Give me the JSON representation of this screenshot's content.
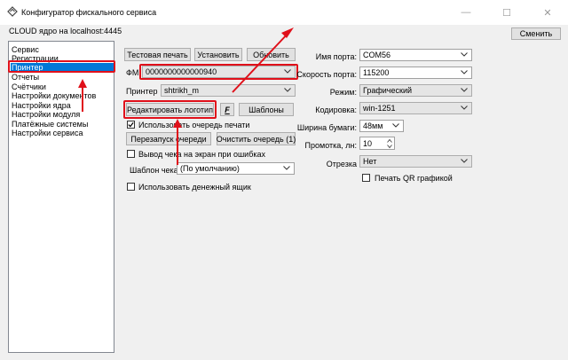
{
  "window": {
    "title": "Конфигуратор фискального сервиса",
    "minimize_glyph": "—",
    "maximize_glyph": "☐",
    "close_glyph": "✕"
  },
  "server_label": "CLOUD ядро на localhost:4445",
  "change_button": "Сменить",
  "sidebar": {
    "items": [
      {
        "label": "Сервис"
      },
      {
        "label": "Регистрации"
      },
      {
        "label": "Принтер",
        "selected": true
      },
      {
        "label": "Отчеты"
      },
      {
        "label": "Счётчики"
      },
      {
        "label": "Настройки документов"
      },
      {
        "label": "Настройки ядра"
      },
      {
        "label": "Настройки модуля"
      },
      {
        "label": "Платёжные системы"
      },
      {
        "label": "Настройки сервиса"
      }
    ]
  },
  "printer": {
    "test_print": "Тестовая печать",
    "install": "Установить",
    "update": "Обновить",
    "fm_label": "ФМ",
    "fm_value": "0000000000000940",
    "printer_label": "Принтер",
    "printer_value": "shtrikh_m",
    "edit_logo": "Редактировать логотип",
    "font_button": "F",
    "templates": "Шаблоны",
    "use_queue": "Использовать очередь печати",
    "use_queue_checked": true,
    "restart_queue": "Перезапуск очереди",
    "clear_queue": "Очистить очередь (1)",
    "show_on_error": "Вывод чека на экран при ошибках",
    "show_on_error_checked": false,
    "template_label": "Шаблон чека",
    "template_value": "(По умолчанию)",
    "cash_drawer": "Использовать денежный ящик",
    "cash_drawer_checked": false
  },
  "port": {
    "port_name_label": "Имя порта:",
    "port_name_value": "COM56",
    "speed_label": "Скорость порта:",
    "speed_value": "115200",
    "mode_label": "Режим:",
    "mode_value": "Графический",
    "encoding_label": "Кодировка:",
    "encoding_value": "win-1251",
    "paper_width_label": "Ширина бумаги:",
    "paper_width_value": "48мм",
    "feed_label": "Промотка, лн:",
    "feed_value": "10",
    "cut_label": "Отрезка",
    "cut_value": "Нет",
    "qr_label": "Печать QR графикой",
    "qr_checked": false
  },
  "colors": {
    "selection": "#0078d7",
    "annotation_red": "#e0101a"
  }
}
